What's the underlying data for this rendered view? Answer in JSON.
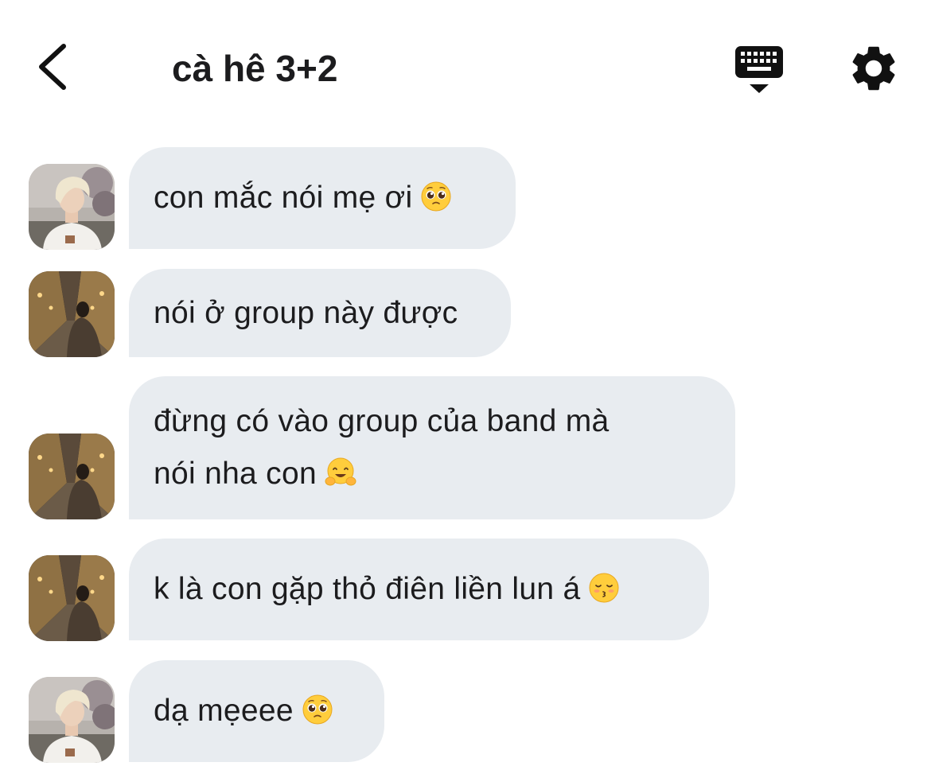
{
  "header": {
    "title": "cà hê 3+2",
    "back_icon": "chevron-left-icon",
    "keyboard_icon": "keyboard-dismiss-icon",
    "settings_icon": "gear-icon"
  },
  "messages": [
    {
      "sender_avatar": "blonde-person-avatar",
      "lines": [
        "con mắc nói mẹ ơi"
      ],
      "emoji": "pleading-face-emoji"
    },
    {
      "sender_avatar": "street-person-avatar",
      "lines": [
        "nói ở group này được"
      ],
      "emoji": ""
    },
    {
      "sender_avatar": "street-person-avatar",
      "lines": [
        "đừng có vào group của band mà",
        "nói nha con"
      ],
      "emoji": "hugging-face-emoji"
    },
    {
      "sender_avatar": "street-person-avatar",
      "lines": [
        "k là con gặp thỏ điên liền lun á"
      ],
      "emoji": "kissing-face-emoji"
    },
    {
      "sender_avatar": "blonde-person-avatar",
      "lines": [
        "dạ mẹeee"
      ],
      "emoji": "pleading-face-emoji"
    }
  ],
  "colors": {
    "bubble": "#e8ecf0",
    "text": "#1c1c1e",
    "icon": "#111111"
  }
}
